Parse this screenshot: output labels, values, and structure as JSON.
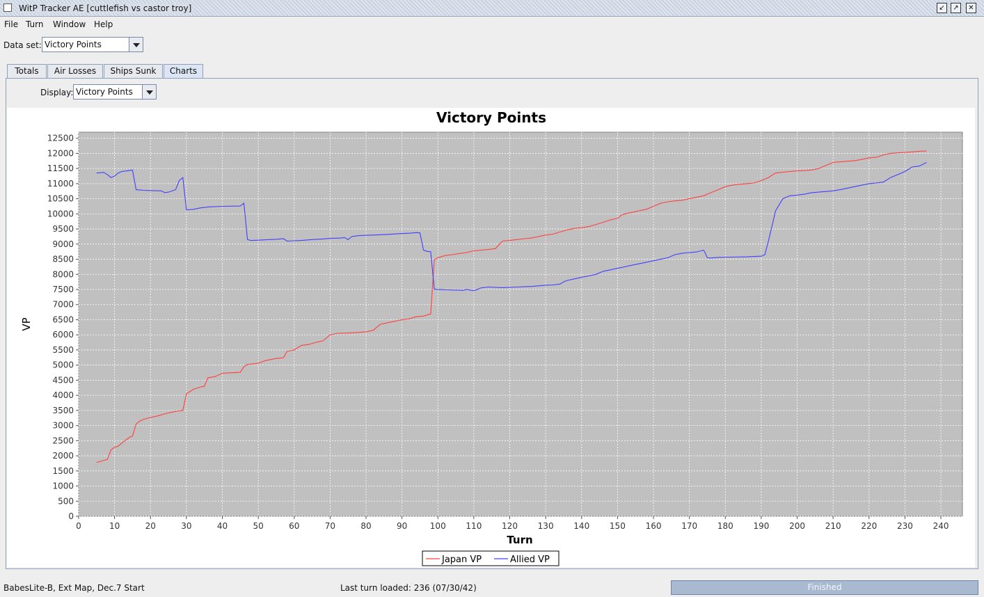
{
  "window": {
    "title": "WitP Tracker AE [cuttlefish vs castor troy]"
  },
  "menu": [
    {
      "label": "File"
    },
    {
      "label": "Turn"
    },
    {
      "label": "Window"
    },
    {
      "label": "Help"
    }
  ],
  "dataset": {
    "label": "Data set:",
    "value": "Victory Points"
  },
  "tabs": [
    {
      "label": "Totals"
    },
    {
      "label": "Air Losses"
    },
    {
      "label": "Ships Sunk"
    },
    {
      "label": "Charts",
      "active": true
    }
  ],
  "display": {
    "label": "Display:",
    "value": "Victory Points"
  },
  "status": {
    "scenario": "BabesLite-B, Ext Map, Dec.7 Start",
    "last_turn": "Last turn loaded: 236 (07/30/42)",
    "progress_label": "Finished",
    "progress_value": 1.0
  },
  "colors": {
    "japan": "#ff4040",
    "allied": "#4040ff",
    "plot_bg": "#c0c0c0"
  },
  "chart_data": {
    "type": "line",
    "title": "Victory Points",
    "xlabel": "Turn",
    "ylabel": "VP",
    "xlim": [
      0,
      246
    ],
    "ylim": [
      0,
      12700
    ],
    "xticks": [
      0,
      10,
      20,
      30,
      40,
      50,
      60,
      70,
      80,
      90,
      100,
      110,
      120,
      130,
      140,
      150,
      160,
      170,
      180,
      190,
      200,
      210,
      220,
      230,
      240
    ],
    "yticks": [
      0,
      500,
      1000,
      1500,
      2000,
      2500,
      3000,
      3500,
      4000,
      4500,
      5000,
      5500,
      6000,
      6500,
      7000,
      7500,
      8000,
      8500,
      9000,
      9500,
      10000,
      10500,
      11000,
      11500,
      12000,
      12500
    ],
    "grid": true,
    "legend": "bottom-center",
    "series": [
      {
        "name": "Japan VP",
        "color": "#ff4040",
        "x": [
          5,
          7,
          8,
          9,
          10,
          11,
          12,
          14,
          15,
          16,
          17,
          18,
          20,
          22,
          25,
          27,
          29,
          30,
          32,
          34,
          35,
          36,
          38,
          40,
          45,
          46,
          47,
          50,
          52,
          55,
          57,
          58,
          60,
          62,
          64,
          66,
          68,
          70,
          72,
          75,
          78,
          80,
          82,
          84,
          86,
          88,
          90,
          92,
          94,
          96,
          98,
          99,
          100,
          102,
          104,
          106,
          108,
          110,
          112,
          114,
          116,
          117,
          118,
          120,
          122,
          124,
          126,
          128,
          130,
          132,
          134,
          136,
          138,
          140,
          142,
          144,
          146,
          148,
          150,
          151,
          152,
          154,
          156,
          158,
          160,
          162,
          164,
          166,
          168,
          170,
          172,
          174,
          176,
          178,
          180,
          182,
          184,
          186,
          188,
          190,
          192,
          194,
          196,
          198,
          200,
          202,
          204,
          206,
          208,
          210,
          212,
          214,
          216,
          218,
          220,
          222,
          224,
          226,
          228,
          230,
          232,
          234,
          236
        ],
        "y": [
          1780,
          1850,
          1880,
          2200,
          2280,
          2320,
          2420,
          2600,
          2650,
          3050,
          3150,
          3200,
          3270,
          3320,
          3420,
          3470,
          3500,
          4050,
          4200,
          4280,
          4300,
          4580,
          4620,
          4730,
          4760,
          4950,
          5020,
          5060,
          5150,
          5220,
          5240,
          5450,
          5500,
          5650,
          5680,
          5750,
          5800,
          6000,
          6050,
          6060,
          6080,
          6100,
          6150,
          6350,
          6400,
          6450,
          6500,
          6530,
          6600,
          6620,
          6690,
          8480,
          8550,
          8620,
          8650,
          8690,
          8720,
          8780,
          8800,
          8820,
          8850,
          8980,
          9100,
          9120,
          9150,
          9180,
          9200,
          9250,
          9300,
          9330,
          9400,
          9470,
          9520,
          9540,
          9580,
          9650,
          9720,
          9800,
          9850,
          9950,
          10000,
          10050,
          10100,
          10150,
          10250,
          10350,
          10400,
          10430,
          10450,
          10500,
          10550,
          10600,
          10700,
          10800,
          10900,
          10950,
          10980,
          11000,
          11020,
          11100,
          11200,
          11350,
          11380,
          11400,
          11420,
          11430,
          11450,
          11500,
          11600,
          11700,
          11720,
          11740,
          11760,
          11800,
          11850,
          11870,
          11950,
          12000,
          12020,
          12030,
          12050,
          12070,
          12080
        ]
      },
      {
        "name": "Allied VP",
        "color": "#4040ff",
        "x": [
          5,
          7,
          8,
          9,
          10,
          11,
          12,
          14,
          15,
          16,
          18,
          20,
          23,
          24,
          25,
          27,
          28,
          29,
          30,
          32,
          34,
          36,
          40,
          45,
          46,
          47,
          48,
          50,
          53,
          55,
          57,
          58,
          60,
          62,
          65,
          68,
          70,
          73,
          74,
          75,
          76,
          78,
          82,
          86,
          90,
          92,
          94,
          95,
          96,
          97,
          98,
          99,
          100,
          102,
          105,
          107,
          108,
          109,
          110,
          111,
          112,
          114,
          118,
          122,
          124,
          126,
          128,
          130,
          132,
          134,
          135,
          136,
          138,
          140,
          142,
          144,
          146,
          148,
          150,
          152,
          154,
          156,
          158,
          160,
          162,
          164,
          166,
          168,
          170,
          172,
          174,
          175,
          176,
          178,
          182,
          186,
          188,
          190,
          191,
          192,
          193,
          194,
          196,
          198,
          200,
          202,
          204,
          206,
          208,
          210,
          212,
          214,
          216,
          218,
          220,
          222,
          224,
          226,
          228,
          230,
          232,
          234,
          236
        ],
        "y": [
          11350,
          11370,
          11300,
          11200,
          11250,
          11350,
          11400,
          11430,
          11450,
          10800,
          10780,
          10770,
          10760,
          10700,
          10720,
          10800,
          11100,
          11200,
          10130,
          10150,
          10200,
          10230,
          10250,
          10260,
          10350,
          9150,
          9120,
          9130,
          9150,
          9160,
          9180,
          9100,
          9110,
          9120,
          9150,
          9170,
          9190,
          9200,
          9220,
          9150,
          9250,
          9280,
          9300,
          9320,
          9350,
          9360,
          9380,
          9370,
          8800,
          8760,
          8750,
          7510,
          7500,
          7490,
          7480,
          7470,
          7500,
          7480,
          7460,
          7500,
          7550,
          7580,
          7560,
          7580,
          7590,
          7600,
          7620,
          7640,
          7650,
          7680,
          7750,
          7800,
          7850,
          7900,
          7950,
          8000,
          8100,
          8150,
          8200,
          8250,
          8300,
          8350,
          8400,
          8450,
          8500,
          8550,
          8650,
          8700,
          8720,
          8740,
          8800,
          8550,
          8540,
          8560,
          8570,
          8580,
          8590,
          8600,
          8650,
          9100,
          9600,
          10100,
          10500,
          10600,
          10620,
          10650,
          10700,
          10720,
          10740,
          10760,
          10800,
          10850,
          10900,
          10950,
          11000,
          11020,
          11050,
          11200,
          11300,
          11400,
          11550,
          11580,
          11700
        ]
      }
    ]
  }
}
